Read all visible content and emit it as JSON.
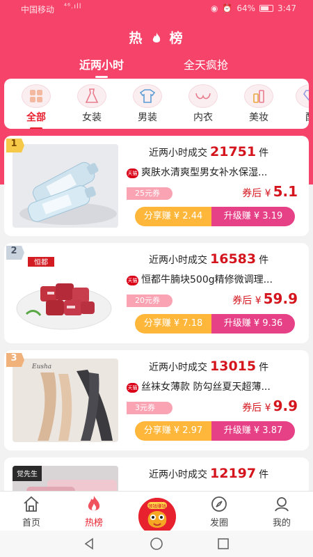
{
  "status_bar": {
    "carrier": "中国移动",
    "signal": "⁴⁶.ıll",
    "battery": "64%",
    "time": "3:47"
  },
  "header": {
    "title_left": "热",
    "title_right": "榜"
  },
  "top_tabs": [
    {
      "label": "近两小时"
    },
    {
      "label": "全天疯抢"
    }
  ],
  "categories": [
    {
      "label": "全部",
      "icon": "grid-icon"
    },
    {
      "label": "女装",
      "icon": "dress-icon"
    },
    {
      "label": "男装",
      "icon": "shirt-icon"
    },
    {
      "label": "内衣",
      "icon": "bra-icon"
    },
    {
      "label": "美妆",
      "icon": "cosmetics-icon"
    },
    {
      "label": "配",
      "icon": "gem-icon"
    }
  ],
  "products": [
    {
      "rank": "1",
      "sales_prefix": "近两小时成交",
      "sales": "21751",
      "sales_unit": "件",
      "shop": "天猫",
      "name": "爽肤水清爽型男女补水保湿...",
      "coupon": "25元券",
      "price_label": "券后",
      "currency": "¥",
      "price": "5.1",
      "share": "分享赚 ¥ 2.44",
      "upgrade": "升级赚 ¥ 3.19"
    },
    {
      "rank": "2",
      "sales_prefix": "近两小时成交",
      "sales": "16583",
      "sales_unit": "件",
      "shop": "天猫",
      "name": "恒都牛腩块500g精修微调理...",
      "coupon": "20元券",
      "price_label": "券后",
      "currency": "¥",
      "price": "59.9",
      "share": "分享赚 ¥ 7.18",
      "upgrade": "升级赚 ¥ 9.36",
      "thumb_brand": "恒都"
    },
    {
      "rank": "3",
      "sales_prefix": "近两小时成交",
      "sales": "13015",
      "sales_unit": "件",
      "shop": "天猫",
      "name": "丝袜女薄款 防勾丝夏天超薄...",
      "coupon": "3元券",
      "price_label": "券后",
      "currency": "¥",
      "price": "9.9",
      "share": "分享赚 ¥ 2.97",
      "upgrade": "升级赚 ¥ 3.87",
      "thumb_brand": "Eusha"
    },
    {
      "rank": "",
      "sales_prefix": "近两小时成交",
      "sales": "12197",
      "sales_unit": "件",
      "thumb_brand": "觉先生"
    }
  ],
  "bottom_nav": [
    {
      "label": "首页",
      "icon": "home-icon"
    },
    {
      "label": "热榜",
      "icon": "flame-icon"
    },
    {
      "label": "领钱赚钱",
      "icon": "mascot-icon"
    },
    {
      "label": "发圈",
      "icon": "compass-icon"
    },
    {
      "label": "我的",
      "icon": "user-icon"
    }
  ],
  "colors": {
    "brand": "#f5436a",
    "price": "#d4151e",
    "share": "#ffb73b",
    "upgrade": "#e64086"
  }
}
